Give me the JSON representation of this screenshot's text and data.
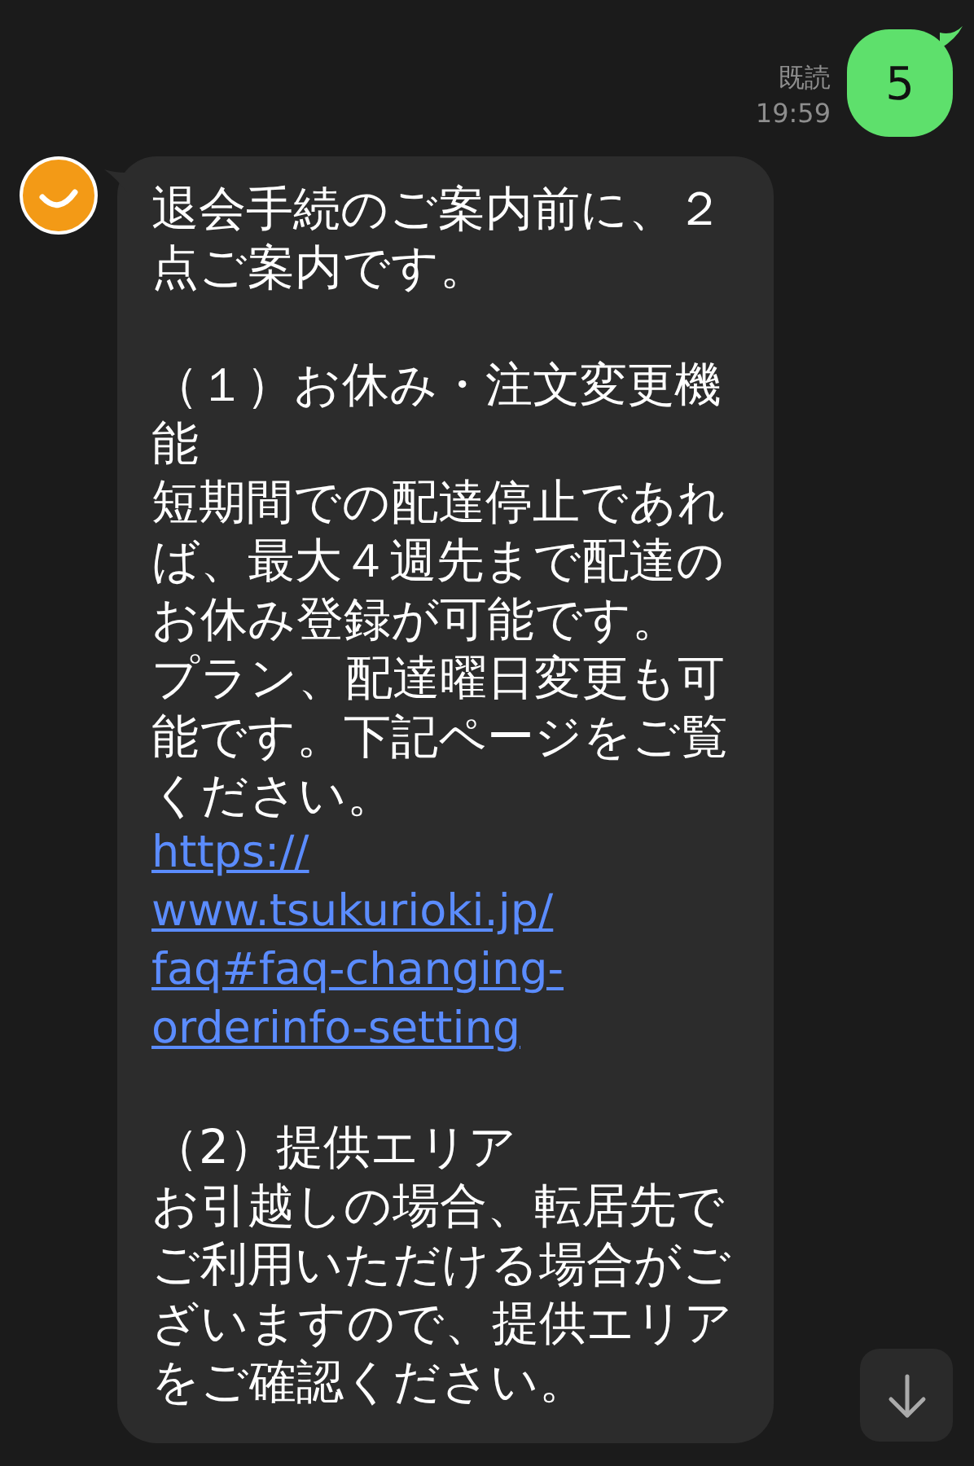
{
  "sent_message": {
    "text": "5",
    "read_label": "既読",
    "time": "19:59"
  },
  "received_message": {
    "blocks": [
      {
        "kind": "text",
        "text": "退会手続のご案内前に、２点ご案内です。"
      },
      {
        "kind": "gap"
      },
      {
        "kind": "text",
        "text": "（１）お休み・注文変更機能"
      },
      {
        "kind": "text",
        "text": "短期間での配達停止であれば、最大４週先まで配達のお休み登録が可能です。"
      },
      {
        "kind": "text",
        "text": "プラン、配達曜日変更も可能です。下記ページをご覧ください。"
      },
      {
        "kind": "link",
        "lines": [
          "https://",
          "www.tsukurioki.jp/",
          "faq#faq-changing-",
          "orderinfo-setting"
        ]
      },
      {
        "kind": "gap"
      },
      {
        "kind": "text",
        "text": "（2）提供エリア"
      },
      {
        "kind": "text",
        "text": "お引越しの場合、転居先でご利用いただける場合がございますので、提供エリアをご確認ください。"
      }
    ]
  }
}
